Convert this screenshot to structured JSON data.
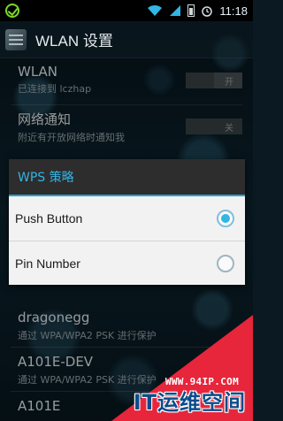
{
  "status_bar": {
    "time": "11:18"
  },
  "action_bar": {
    "title": "WLAN 设置"
  },
  "settings": {
    "wlan": {
      "title": "WLAN",
      "subtitle": "已连接到 lczhap",
      "toggle": "开"
    },
    "notify": {
      "title": "网络通知",
      "subtitle": "附近有开放网络时通知我",
      "toggle": "关"
    }
  },
  "dialog": {
    "title": "WPS 策略",
    "options": [
      {
        "label": "Push Button",
        "selected": true
      },
      {
        "label": "Pin Number",
        "selected": false
      }
    ]
  },
  "networks": [
    {
      "name": "dragonegg",
      "security": "通过 WPA/WPA2 PSK 进行保护"
    },
    {
      "name": "A101E-DEV",
      "security": "通过 WPA/WPA2 PSK 进行保护"
    },
    {
      "name": "A101E",
      "security": ""
    }
  ],
  "watermark": {
    "url": "WWW.94IP.COM",
    "brand": "IT运维空间"
  },
  "colors": {
    "accent": "#33b5e5",
    "watermark_red": "#e7253b"
  }
}
